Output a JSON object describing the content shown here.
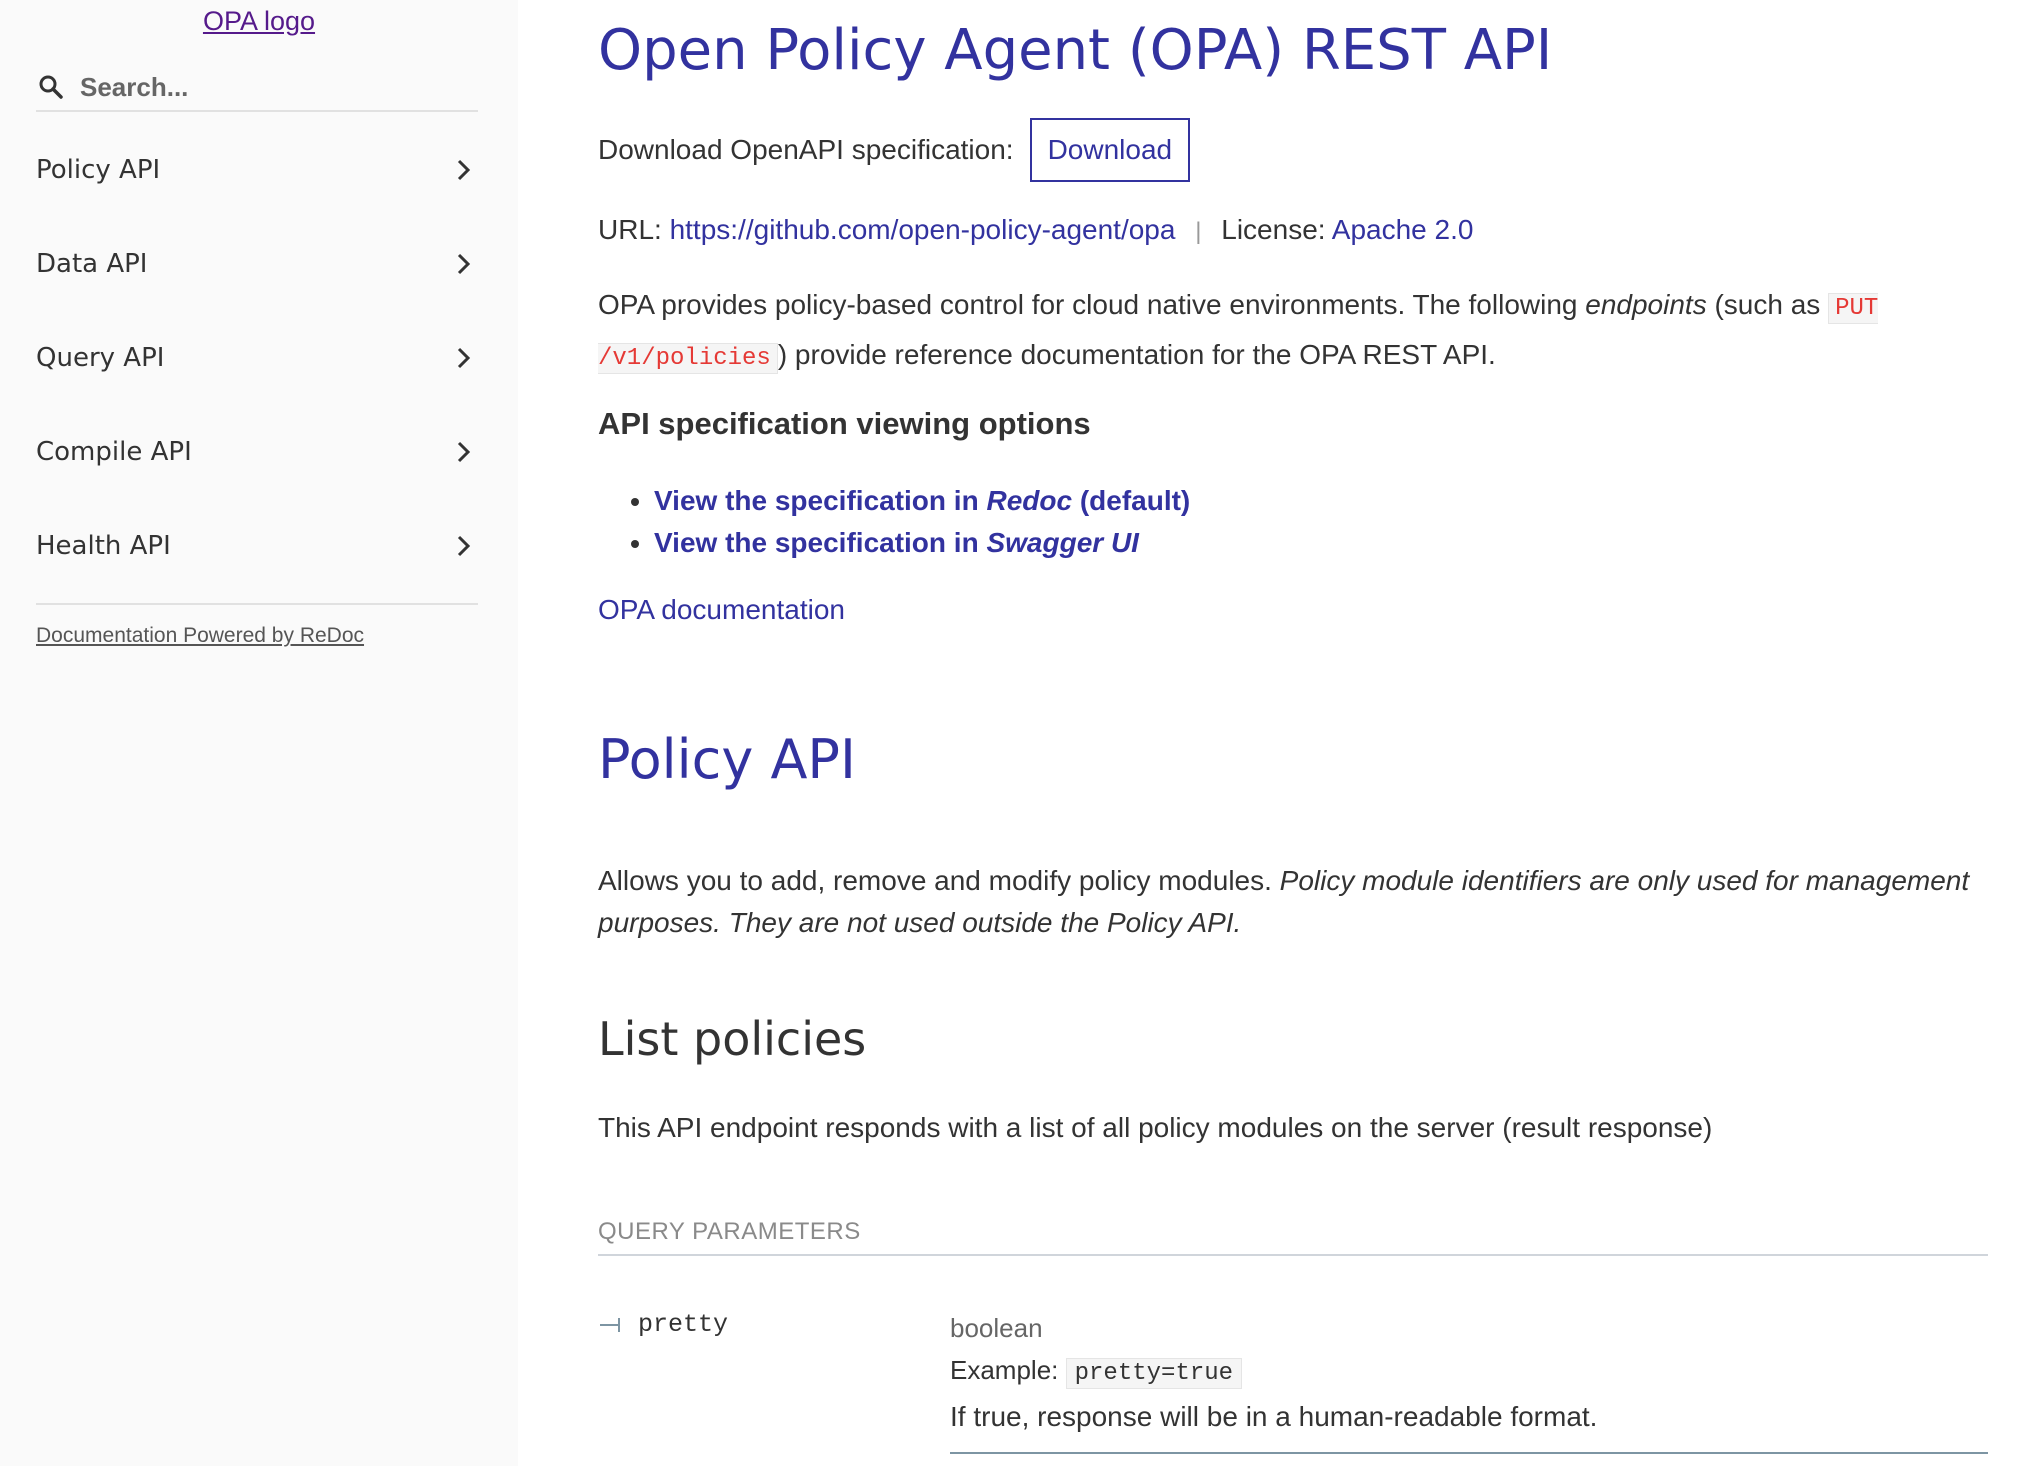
{
  "sidebar": {
    "logo_alt": "OPA logo",
    "search": {
      "placeholder": "Search...",
      "icon": "search-icon"
    },
    "items": [
      {
        "label": "Policy API",
        "icon": "chevron-right-icon"
      },
      {
        "label": "Data API",
        "icon": "chevron-right-icon"
      },
      {
        "label": "Query API",
        "icon": "chevron-right-icon"
      },
      {
        "label": "Compile API",
        "icon": "chevron-right-icon"
      },
      {
        "label": "Health API",
        "icon": "chevron-right-icon"
      }
    ],
    "powered_by": "Documentation Powered by ReDoc"
  },
  "main": {
    "title": "Open Policy Agent (OPA) REST API",
    "download_label": "Download OpenAPI specification:",
    "download_button": "Download",
    "url_label": "URL:",
    "url": "https://github.com/open-policy-agent/opa",
    "separator": "|",
    "license_label": "License:",
    "license": "Apache 2.0",
    "description": {
      "part1": "OPA provides policy-based control for cloud native environments. The following ",
      "emph": "endpoints",
      "part2": " (such as ",
      "code": "PUT /v1/policies",
      "part3": ") provide reference documentation for the OPA REST API."
    },
    "viewing_options_heading": "API specification viewing options",
    "viewing_options": [
      {
        "prefix": "View the specification in ",
        "emph": "Redoc",
        "suffix": " (default)"
      },
      {
        "prefix": "View the specification in ",
        "emph": "Swagger UI",
        "suffix": ""
      }
    ],
    "opa_docs_link": "OPA documentation",
    "section": {
      "title": "Policy API",
      "desc_plain": "Allows you to add, remove and modify policy modules. ",
      "desc_emph": "Policy module identifiers are only used for management purposes. They are not used outside the Policy API."
    },
    "operation": {
      "title": "List policies",
      "description": "This API endpoint responds with a list of all policy modules on the server (result response)",
      "params_header": "QUERY PARAMETERS",
      "params": [
        {
          "name": "pretty",
          "type": "boolean",
          "example_label": "Example:",
          "example": "pretty=true",
          "description": "If true, response will be in a human-readable format."
        }
      ]
    }
  },
  "colors": {
    "accent": "#32329f",
    "code_red": "#e53935",
    "sidebar_bg": "#fafafa"
  }
}
